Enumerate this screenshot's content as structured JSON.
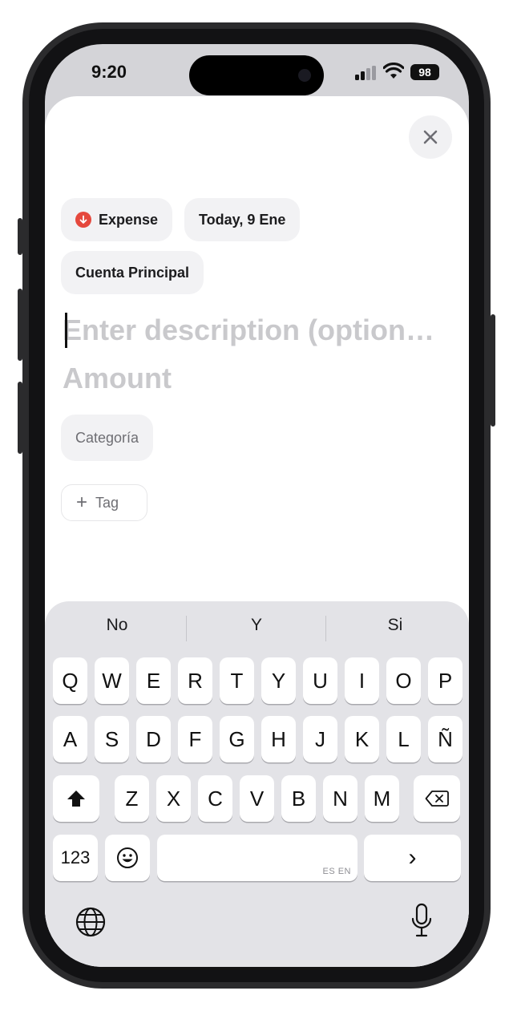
{
  "status_bar": {
    "time": "9:20",
    "battery": "98"
  },
  "sheet": {
    "type_chip": "Expense",
    "date_chip": "Today, 9 Ene",
    "account_chip": "Cuenta Principal",
    "description_placeholder": "Enter description (option…",
    "amount_placeholder": "Amount",
    "category_chip": "Categoría",
    "tag_label": "Tag"
  },
  "keyboard": {
    "suggestions": [
      "No",
      "Y",
      "Si"
    ],
    "row1": [
      "Q",
      "W",
      "E",
      "R",
      "T",
      "Y",
      "U",
      "I",
      "O",
      "P"
    ],
    "row2": [
      "A",
      "S",
      "D",
      "F",
      "G",
      "H",
      "J",
      "K",
      "L",
      "Ñ"
    ],
    "row3": [
      "Z",
      "X",
      "C",
      "V",
      "B",
      "N",
      "M"
    ],
    "numbers_key": "123",
    "space_hint": "ES EN",
    "return_key": "›"
  },
  "colors": {
    "expense_red": "#e5483d",
    "placeholder": "#c9c9cc",
    "keyboard_bg": "#e3e3e7"
  }
}
